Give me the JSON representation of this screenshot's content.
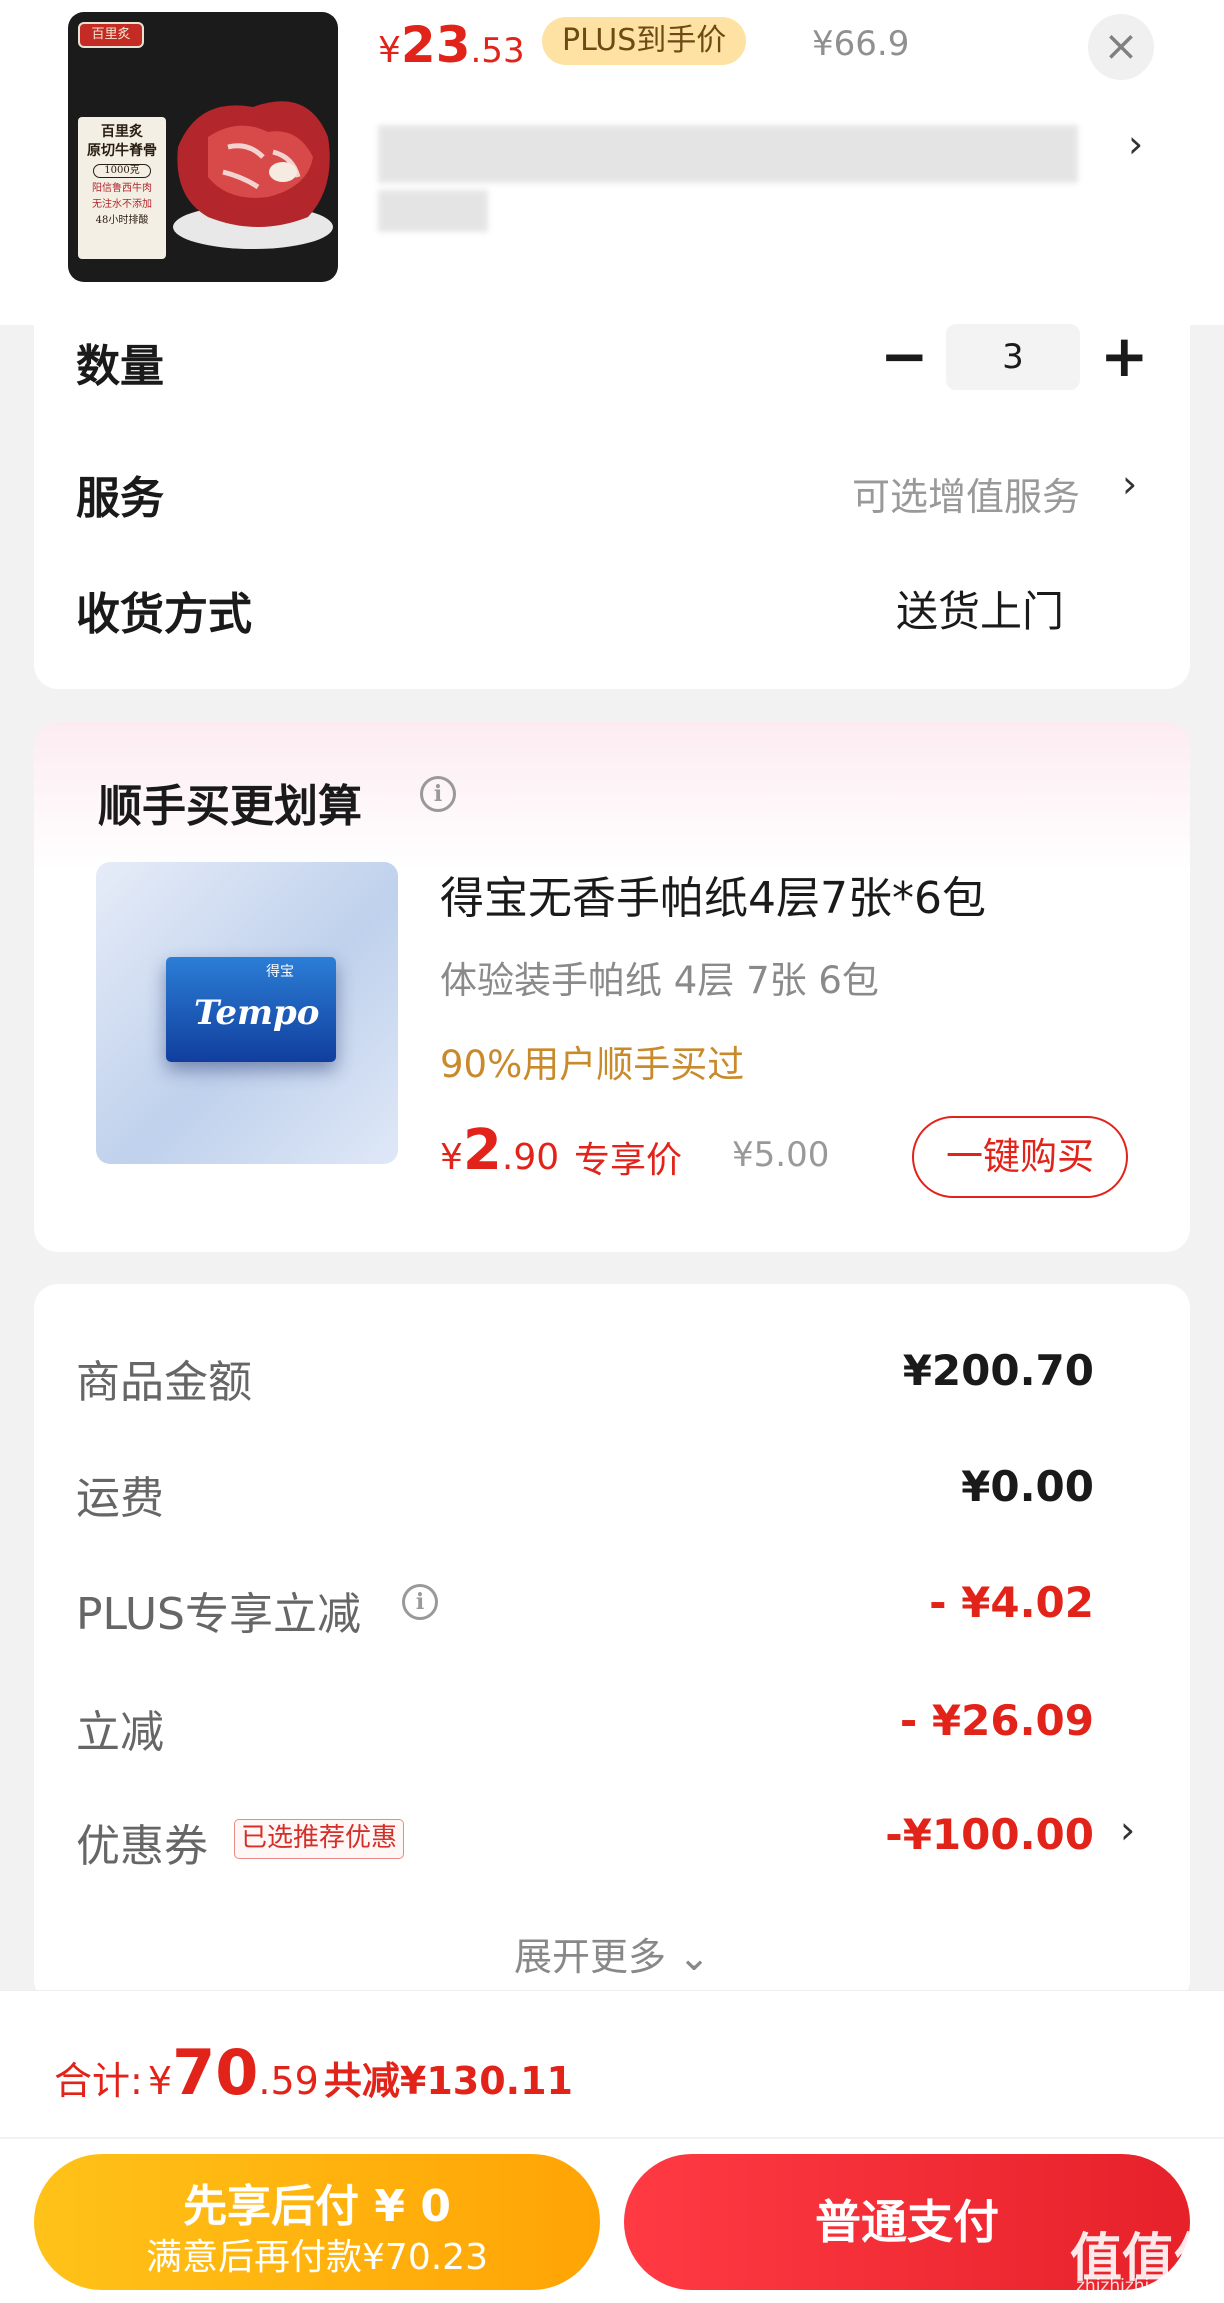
{
  "product": {
    "thumb_brand": "百里炙",
    "thumb_title": "百里炙",
    "thumb_title2": "原切牛脊骨",
    "thumb_weight": "1000克",
    "thumb_line1": "阳信鲁西牛肉",
    "thumb_line2": "无注水不添加",
    "thumb_line3": "48小时排酸",
    "price_symbol": "¥",
    "price_int": "23",
    "price_dec": ".53",
    "plus_label": "PLUS到手价",
    "original_price": "¥66.9",
    "close_icon": "close-icon",
    "spec_chevron": "›"
  },
  "order": {
    "quantity_label": "数量",
    "quantity_value": "3",
    "minus": "−",
    "plus": "+",
    "service_label": "服务",
    "service_value": "可选增值服务",
    "chevron": "›",
    "delivery_label": "收货方式",
    "delivery_value": "送货上门"
  },
  "addon": {
    "section_title": "顺手买更划算",
    "info_icon": "i",
    "product_name": "得宝无香手帕纸4层7张*6包",
    "subtitle": "体验装手帕纸 4层 7张 6包",
    "social_proof": "90%用户顺手买过",
    "price_symbol": "¥",
    "price_int": "2",
    "price_dec": ".90",
    "exclusive_label": "专享价",
    "original_price": "¥5.00",
    "buy_button": "一键购买",
    "image_text": "Tempo",
    "image_text2": "得宝"
  },
  "summary": {
    "rows": [
      {
        "label": "商品金额",
        "value": "¥200.70"
      },
      {
        "label": "运费",
        "value": "¥0.00"
      },
      {
        "label": "PLUS专享立减",
        "value": "- ¥4.02"
      },
      {
        "label": "立减",
        "value": "- ¥26.09"
      },
      {
        "label": "优惠券",
        "value": "-¥100.00"
      }
    ],
    "coupon_tag": "已选推荐优惠",
    "expand_more": "展开更多 ⌄"
  },
  "footer": {
    "total_label": "合计:",
    "total_symbol": "¥",
    "total_int": "70",
    "total_dec": ".59",
    "savings": "共减¥130.11",
    "pay_later_title": "先享后付 ¥ 0",
    "pay_later_sub": "满意后再付款¥70.23",
    "pay_normal": "普通支付",
    "watermark": "值值值",
    "watermark_url": "zhizhizhi.com"
  },
  "colors": {
    "accent": "#e2231a",
    "gold": "#ffb20f",
    "plus_tag": "#fde2a3"
  }
}
